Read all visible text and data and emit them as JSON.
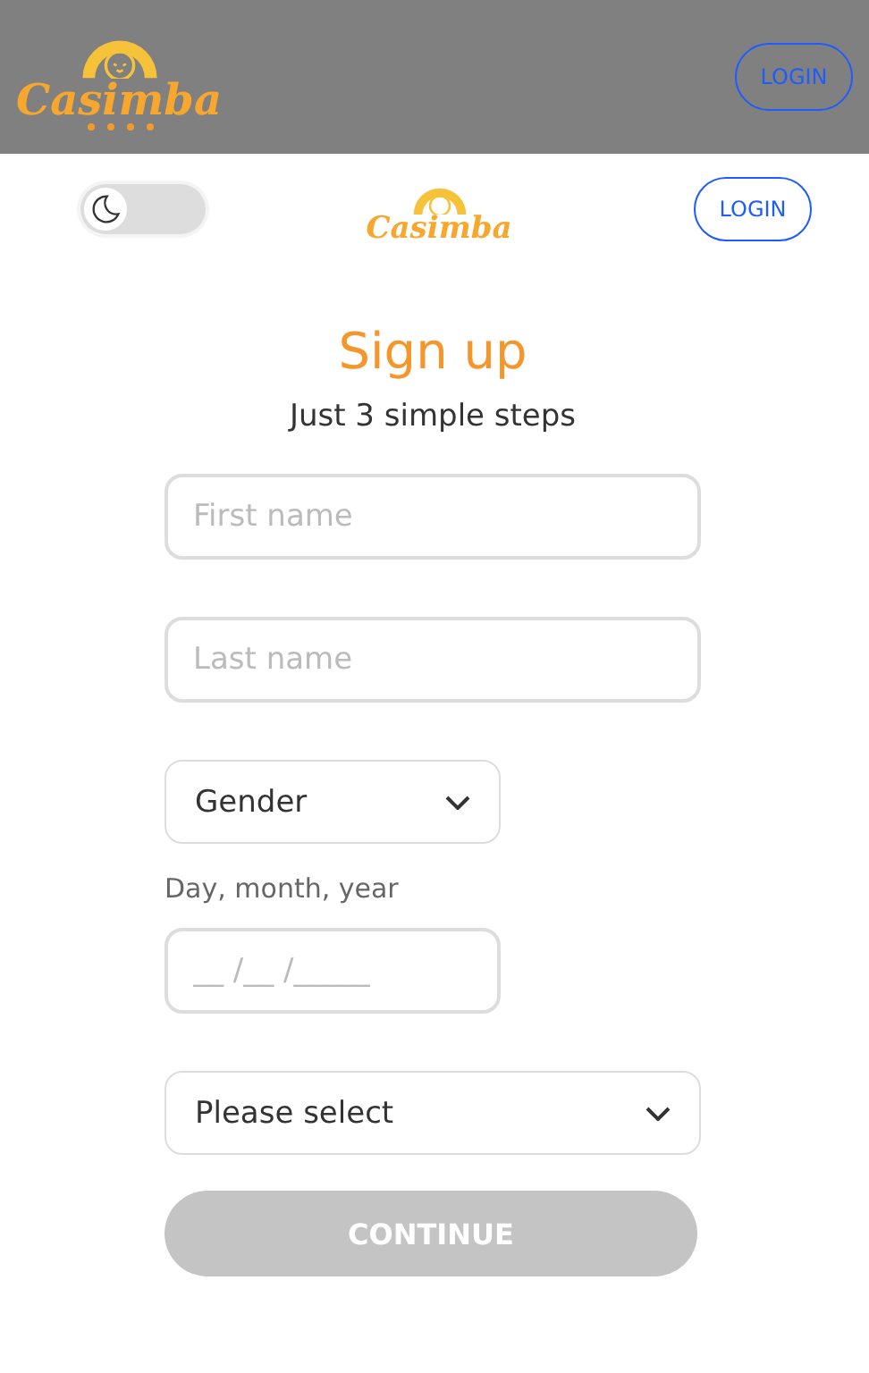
{
  "top_bar": {
    "logo": "Casimba",
    "login_button": "LOGIN"
  },
  "header": {
    "dark_mode_toggle": {
      "on": false
    },
    "logo": "Casimba",
    "login_button": "LOGIN"
  },
  "form": {
    "title": "Sign up",
    "subtitle": "Just 3 simple steps",
    "fields": [
      {
        "kind": "input",
        "placeholder": "First name",
        "narrow": false
      },
      {
        "kind": "input",
        "placeholder": "Last name",
        "narrow": false
      },
      {
        "kind": "select",
        "value": "Gender",
        "narrow": true
      },
      {
        "kind": "label",
        "text": "Day, month, year"
      },
      {
        "kind": "input",
        "placeholder": "__ /__ /_____",
        "narrow": true
      },
      {
        "kind": "select",
        "value": "Please select",
        "narrow": false
      }
    ],
    "continue_button": {
      "label": "CONTINUE",
      "disabled": true
    }
  }
}
